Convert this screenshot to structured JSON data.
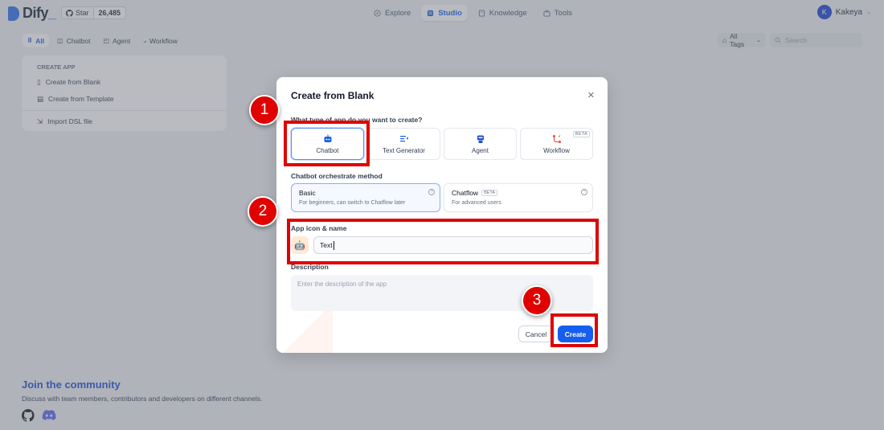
{
  "brand": {
    "name": "Dify",
    "accent": "#155eef"
  },
  "github": {
    "star_label": "Star",
    "star_count": "26,485"
  },
  "nav": [
    {
      "label": "Explore",
      "icon": "compass-icon",
      "active": false
    },
    {
      "label": "Studio",
      "icon": "studio-icon",
      "active": true
    },
    {
      "label": "Knowledge",
      "icon": "book-icon",
      "active": false
    },
    {
      "label": "Tools",
      "icon": "toolbox-icon",
      "active": false
    }
  ],
  "user": {
    "initial": "K",
    "name": "Kakeya"
  },
  "filters": [
    {
      "label": "All",
      "active": true
    },
    {
      "label": "Chatbot",
      "active": false
    },
    {
      "label": "Agent",
      "active": false
    },
    {
      "label": "Workflow",
      "active": false
    }
  ],
  "tags_label": "All Tags",
  "search": {
    "placeholder": "Search"
  },
  "create_app": {
    "header": "CREATE APP",
    "blank": "Create from Blank",
    "template": "Create from Template",
    "import": "Import DSL file"
  },
  "community": {
    "title": "Join the community",
    "subtitle": "Discuss with team members, contributors and developers on different channels."
  },
  "dialog": {
    "title": "Create from Blank",
    "type_question": "What type of app do you want to create?",
    "types": [
      {
        "label": "Chatbot",
        "icon": "chatbot-icon",
        "selected": true,
        "beta": ""
      },
      {
        "label": "Text Generator",
        "icon": "text-generator-icon",
        "selected": false,
        "beta": ""
      },
      {
        "label": "Agent",
        "icon": "agent-icon",
        "selected": false,
        "beta": ""
      },
      {
        "label": "Workflow",
        "icon": "workflow-icon",
        "selected": false,
        "beta": "BETA"
      }
    ],
    "method_label": "Chatbot orchestrate method",
    "methods": [
      {
        "title": "Basic",
        "desc": "For beginners, can switch to Chatflow later",
        "selected": true,
        "beta": ""
      },
      {
        "title": "Chatflow",
        "desc": "For advanced users",
        "selected": false,
        "beta": "BETA"
      }
    ],
    "name_label": "App icon & name",
    "name_value": "Text",
    "description_label": "Description",
    "description_placeholder": "Enter the description of the app",
    "cancel": "Cancel",
    "create": "Create"
  },
  "annotations": [
    {
      "number": "1"
    },
    {
      "number": "2"
    },
    {
      "number": "3"
    }
  ]
}
